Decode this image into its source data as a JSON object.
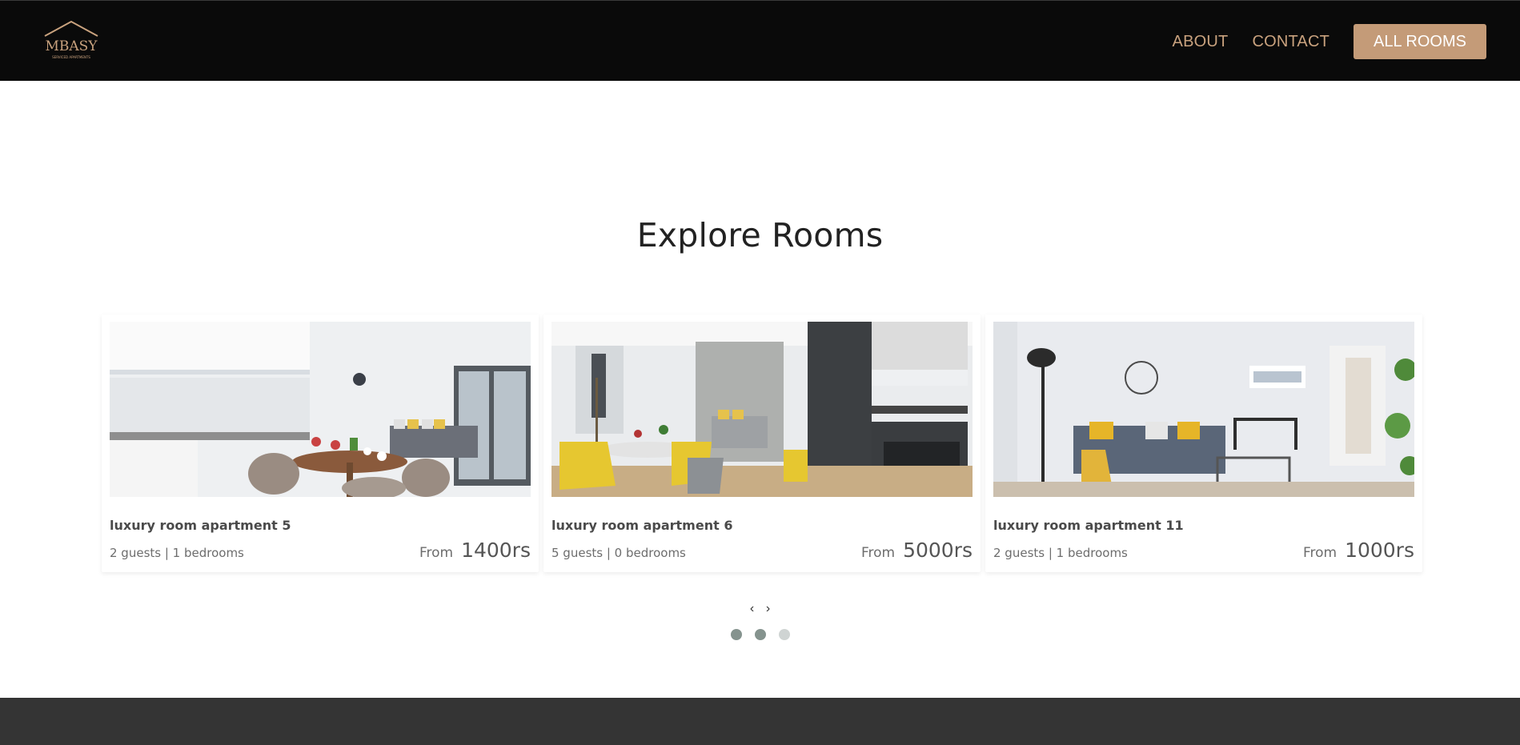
{
  "header": {
    "logo_text": "MBASY",
    "logo_subtext": "SERVICED APARTMENTS",
    "nav": [
      {
        "label": "ABOUT"
      },
      {
        "label": "CONTACT"
      }
    ],
    "cta_label": "ALL ROOMS"
  },
  "main": {
    "title": "Explore Rooms",
    "rooms": [
      {
        "name": "luxury room apartment 5",
        "details": "2 guests | 1 bedrooms",
        "from_label": "From",
        "price": "1400rs"
      },
      {
        "name": "luxury room apartment 6",
        "details": "5 guests | 0 bedrooms",
        "from_label": "From",
        "price": "5000rs"
      },
      {
        "name": "luxury room apartment 11",
        "details": "2 guests | 1 bedrooms",
        "from_label": "From",
        "price": "1000rs"
      }
    ],
    "carousel": {
      "prev_glyph": "‹",
      "next_glyph": "›",
      "dots": [
        true,
        true,
        false
      ]
    }
  },
  "colors": {
    "header_bg": "#0a0a0a",
    "accent": "#c49b78",
    "nav_text": "#c9a27e",
    "dot_active": "#85938e",
    "dot_inactive": "#cfd4d3",
    "footer_bg": "#343434"
  },
  "icons": {
    "logo": "house-roof-logo",
    "prev": "chevron-left-icon",
    "next": "chevron-right-icon"
  }
}
